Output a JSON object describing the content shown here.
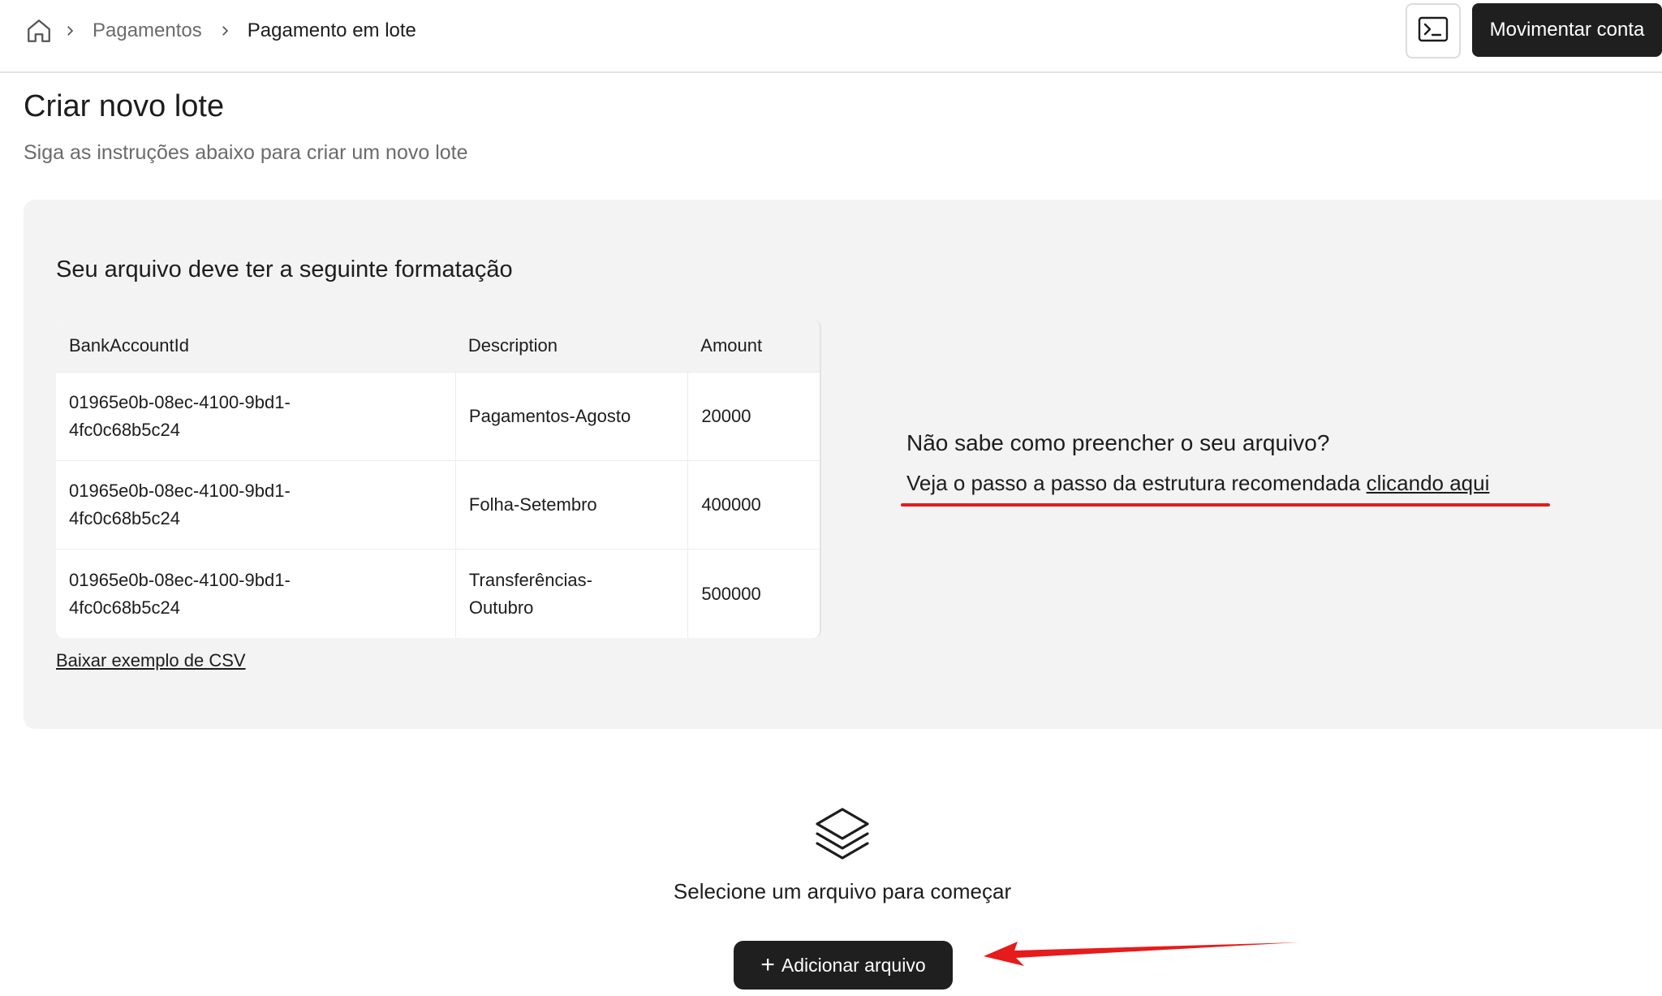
{
  "breadcrumb": {
    "items": [
      "Pagamentos",
      "Pagamento em lote"
    ]
  },
  "header": {
    "move_account_label": "Movimentar conta"
  },
  "page": {
    "title": "Criar novo lote",
    "subtitle": "Siga as instruções abaixo para criar um novo lote"
  },
  "format_card": {
    "title": "Seu arquivo deve ter a seguinte formatação",
    "columns": [
      "BankAccountId",
      "Description",
      "Amount"
    ],
    "rows": [
      [
        "01965e0b-08ec-4100-9bd1-4fc0c68b5c24",
        "Pagamentos-Agosto",
        "20000"
      ],
      [
        "01965e0b-08ec-4100-9bd1-4fc0c68b5c24",
        "Folha-Setembro",
        "400000"
      ],
      [
        "01965e0b-08ec-4100-9bd1-4fc0c68b5c24",
        "Transferências-Outubro",
        "500000"
      ]
    ],
    "csv_link": "Baixar exemplo de CSV"
  },
  "help": {
    "title": "Não sabe como preencher o seu arquivo?",
    "text": "Veja o passo a passo da estrutura recomendada ",
    "link": "clicando aqui"
  },
  "upload": {
    "prompt": "Selecione um arquivo para começar",
    "button_label": "Adicionar arquivo"
  },
  "colors": {
    "annotation_red": "#e61b1b",
    "button_dark": "#1f1f1f",
    "card_bg": "#f3f3f3"
  },
  "icons": [
    "home-icon",
    "chevron-right-icon",
    "terminal-icon",
    "layers-icon",
    "plus-icon"
  ]
}
